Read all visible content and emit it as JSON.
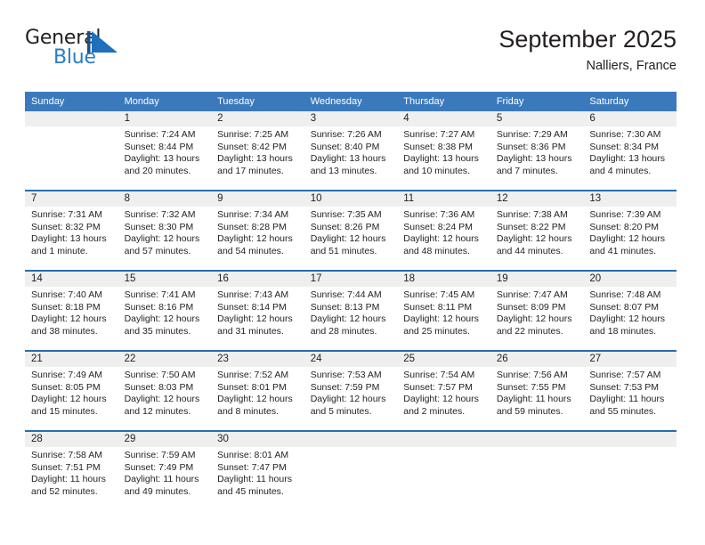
{
  "brand": {
    "name_part1": "General",
    "name_part2": "Blue",
    "logo_icon": "sail-triangle-icon",
    "accent_color": "#2b7cc4"
  },
  "header": {
    "title": "September 2025",
    "subtitle": "Nalliers, France"
  },
  "theme": {
    "header_blue": "#3b79bd",
    "row_divider_blue": "#2b6cb0",
    "daynum_band_gray": "#efefef",
    "text_color": "#231f20"
  },
  "calendar": {
    "weekday_headers": [
      "Sunday",
      "Monday",
      "Tuesday",
      "Wednesday",
      "Thursday",
      "Friday",
      "Saturday"
    ],
    "weeks": [
      [
        {
          "day": "",
          "sunrise": "",
          "sunset": "",
          "daylight_line1": "",
          "daylight_line2": ""
        },
        {
          "day": "1",
          "sunrise": "Sunrise: 7:24 AM",
          "sunset": "Sunset: 8:44 PM",
          "daylight_line1": "Daylight: 13 hours",
          "daylight_line2": "and 20 minutes."
        },
        {
          "day": "2",
          "sunrise": "Sunrise: 7:25 AM",
          "sunset": "Sunset: 8:42 PM",
          "daylight_line1": "Daylight: 13 hours",
          "daylight_line2": "and 17 minutes."
        },
        {
          "day": "3",
          "sunrise": "Sunrise: 7:26 AM",
          "sunset": "Sunset: 8:40 PM",
          "daylight_line1": "Daylight: 13 hours",
          "daylight_line2": "and 13 minutes."
        },
        {
          "day": "4",
          "sunrise": "Sunrise: 7:27 AM",
          "sunset": "Sunset: 8:38 PM",
          "daylight_line1": "Daylight: 13 hours",
          "daylight_line2": "and 10 minutes."
        },
        {
          "day": "5",
          "sunrise": "Sunrise: 7:29 AM",
          "sunset": "Sunset: 8:36 PM",
          "daylight_line1": "Daylight: 13 hours",
          "daylight_line2": "and 7 minutes."
        },
        {
          "day": "6",
          "sunrise": "Sunrise: 7:30 AM",
          "sunset": "Sunset: 8:34 PM",
          "daylight_line1": "Daylight: 13 hours",
          "daylight_line2": "and 4 minutes."
        }
      ],
      [
        {
          "day": "7",
          "sunrise": "Sunrise: 7:31 AM",
          "sunset": "Sunset: 8:32 PM",
          "daylight_line1": "Daylight: 13 hours",
          "daylight_line2": "and 1 minute."
        },
        {
          "day": "8",
          "sunrise": "Sunrise: 7:32 AM",
          "sunset": "Sunset: 8:30 PM",
          "daylight_line1": "Daylight: 12 hours",
          "daylight_line2": "and 57 minutes."
        },
        {
          "day": "9",
          "sunrise": "Sunrise: 7:34 AM",
          "sunset": "Sunset: 8:28 PM",
          "daylight_line1": "Daylight: 12 hours",
          "daylight_line2": "and 54 minutes."
        },
        {
          "day": "10",
          "sunrise": "Sunrise: 7:35 AM",
          "sunset": "Sunset: 8:26 PM",
          "daylight_line1": "Daylight: 12 hours",
          "daylight_line2": "and 51 minutes."
        },
        {
          "day": "11",
          "sunrise": "Sunrise: 7:36 AM",
          "sunset": "Sunset: 8:24 PM",
          "daylight_line1": "Daylight: 12 hours",
          "daylight_line2": "and 48 minutes."
        },
        {
          "day": "12",
          "sunrise": "Sunrise: 7:38 AM",
          "sunset": "Sunset: 8:22 PM",
          "daylight_line1": "Daylight: 12 hours",
          "daylight_line2": "and 44 minutes."
        },
        {
          "day": "13",
          "sunrise": "Sunrise: 7:39 AM",
          "sunset": "Sunset: 8:20 PM",
          "daylight_line1": "Daylight: 12 hours",
          "daylight_line2": "and 41 minutes."
        }
      ],
      [
        {
          "day": "14",
          "sunrise": "Sunrise: 7:40 AM",
          "sunset": "Sunset: 8:18 PM",
          "daylight_line1": "Daylight: 12 hours",
          "daylight_line2": "and 38 minutes."
        },
        {
          "day": "15",
          "sunrise": "Sunrise: 7:41 AM",
          "sunset": "Sunset: 8:16 PM",
          "daylight_line1": "Daylight: 12 hours",
          "daylight_line2": "and 35 minutes."
        },
        {
          "day": "16",
          "sunrise": "Sunrise: 7:43 AM",
          "sunset": "Sunset: 8:14 PM",
          "daylight_line1": "Daylight: 12 hours",
          "daylight_line2": "and 31 minutes."
        },
        {
          "day": "17",
          "sunrise": "Sunrise: 7:44 AM",
          "sunset": "Sunset: 8:13 PM",
          "daylight_line1": "Daylight: 12 hours",
          "daylight_line2": "and 28 minutes."
        },
        {
          "day": "18",
          "sunrise": "Sunrise: 7:45 AM",
          "sunset": "Sunset: 8:11 PM",
          "daylight_line1": "Daylight: 12 hours",
          "daylight_line2": "and 25 minutes."
        },
        {
          "day": "19",
          "sunrise": "Sunrise: 7:47 AM",
          "sunset": "Sunset: 8:09 PM",
          "daylight_line1": "Daylight: 12 hours",
          "daylight_line2": "and 22 minutes."
        },
        {
          "day": "20",
          "sunrise": "Sunrise: 7:48 AM",
          "sunset": "Sunset: 8:07 PM",
          "daylight_line1": "Daylight: 12 hours",
          "daylight_line2": "and 18 minutes."
        }
      ],
      [
        {
          "day": "21",
          "sunrise": "Sunrise: 7:49 AM",
          "sunset": "Sunset: 8:05 PM",
          "daylight_line1": "Daylight: 12 hours",
          "daylight_line2": "and 15 minutes."
        },
        {
          "day": "22",
          "sunrise": "Sunrise: 7:50 AM",
          "sunset": "Sunset: 8:03 PM",
          "daylight_line1": "Daylight: 12 hours",
          "daylight_line2": "and 12 minutes."
        },
        {
          "day": "23",
          "sunrise": "Sunrise: 7:52 AM",
          "sunset": "Sunset: 8:01 PM",
          "daylight_line1": "Daylight: 12 hours",
          "daylight_line2": "and 8 minutes."
        },
        {
          "day": "24",
          "sunrise": "Sunrise: 7:53 AM",
          "sunset": "Sunset: 7:59 PM",
          "daylight_line1": "Daylight: 12 hours",
          "daylight_line2": "and 5 minutes."
        },
        {
          "day": "25",
          "sunrise": "Sunrise: 7:54 AM",
          "sunset": "Sunset: 7:57 PM",
          "daylight_line1": "Daylight: 12 hours",
          "daylight_line2": "and 2 minutes."
        },
        {
          "day": "26",
          "sunrise": "Sunrise: 7:56 AM",
          "sunset": "Sunset: 7:55 PM",
          "daylight_line1": "Daylight: 11 hours",
          "daylight_line2": "and 59 minutes."
        },
        {
          "day": "27",
          "sunrise": "Sunrise: 7:57 AM",
          "sunset": "Sunset: 7:53 PM",
          "daylight_line1": "Daylight: 11 hours",
          "daylight_line2": "and 55 minutes."
        }
      ],
      [
        {
          "day": "28",
          "sunrise": "Sunrise: 7:58 AM",
          "sunset": "Sunset: 7:51 PM",
          "daylight_line1": "Daylight: 11 hours",
          "daylight_line2": "and 52 minutes."
        },
        {
          "day": "29",
          "sunrise": "Sunrise: 7:59 AM",
          "sunset": "Sunset: 7:49 PM",
          "daylight_line1": "Daylight: 11 hours",
          "daylight_line2": "and 49 minutes."
        },
        {
          "day": "30",
          "sunrise": "Sunrise: 8:01 AM",
          "sunset": "Sunset: 7:47 PM",
          "daylight_line1": "Daylight: 11 hours",
          "daylight_line2": "and 45 minutes."
        },
        {
          "day": "",
          "sunrise": "",
          "sunset": "",
          "daylight_line1": "",
          "daylight_line2": ""
        },
        {
          "day": "",
          "sunrise": "",
          "sunset": "",
          "daylight_line1": "",
          "daylight_line2": ""
        },
        {
          "day": "",
          "sunrise": "",
          "sunset": "",
          "daylight_line1": "",
          "daylight_line2": ""
        },
        {
          "day": "",
          "sunrise": "",
          "sunset": "",
          "daylight_line1": "",
          "daylight_line2": ""
        }
      ]
    ]
  }
}
